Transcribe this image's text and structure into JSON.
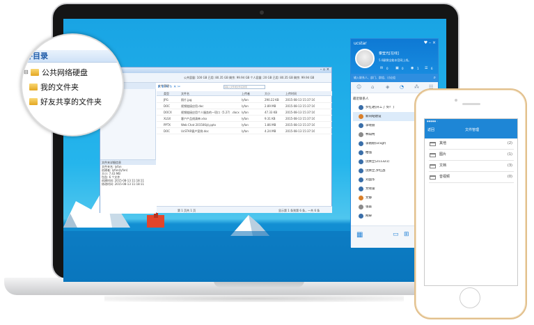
{
  "lens": {
    "title": "件目录",
    "items": [
      "公共网络硬盘",
      "我的文件夹",
      "好友共享的文件夹"
    ]
  },
  "file_manager": {
    "header": "文件管理",
    "quota": "公共容量: 100 GB  已用: 80.35 GB  剩余: 99.94 GB  个人容量: 20 GB  已用: 80.35 GB  剩余: 99.94 GB",
    "search_placeholder": "请输入文件或文件名搜索",
    "columns": [
      "类型",
      "文件名",
      "上传者",
      "大小",
      "上传时间"
    ],
    "rows": [
      {
        "type": "JPG",
        "name": "照片.jpg",
        "uploader": "lyfan",
        "size": "290.22 KB",
        "time": "2015-08-13 15:37:16"
      },
      {
        "type": "DOC",
        "name": "视频链接应用.doc",
        "uploader": "lyfan",
        "size": "2.89 MB",
        "time": "2015-08-13 15:37:16"
      },
      {
        "type": "DOCX",
        "name": "视频链接应用个人服务的一项口（5.27）.docx",
        "uploader": "lyfan",
        "size": "47.33 KB",
        "time": "2015-08-13 15:37:16"
      },
      {
        "type": "XLSX",
        "name": "客户产品线清单.xlsx",
        "uploader": "lyfan",
        "size": "9.31 KB",
        "time": "2015-08-13 15:37:16"
      },
      {
        "type": "PPTX",
        "name": "Web Chat 201506训.pptx",
        "uploader": "lyfan",
        "size": "1.86 MB",
        "time": "2015-08-13 15:37:16"
      },
      {
        "type": "DOC",
        "name": "UcSTAR客户案例.doc",
        "uploader": "lyfan",
        "size": "4.24 MB",
        "time": "2015-08-13 15:37:16"
      }
    ],
    "detail_title": "文件夹详细信息",
    "detail_lines": [
      "文件夹名: lyfan",
      "创建者: lyfan(lyfan)",
      "大小: 7.43 MB",
      "包含: 6 个文件",
      "创建时间: 2015-08-13 11:18:11",
      "修改时间: 2015-08-13 11:18:11"
    ],
    "pager": "第 1 页共 1 页",
    "status": "显示第 1 条到第 6 条，一共 6 条"
  },
  "ucstar": {
    "app_name": "ucstar",
    "user_name": "秦莹光[在线]",
    "signature": "5.0颠倒全能本官网上线。",
    "counts": [
      "0",
      "0",
      "1",
      "6"
    ],
    "search_placeholder": "输入联系人、部门、群组、讨论组",
    "section": "最近联系人",
    "contacts": [
      "罗红艳[开工了 好！]",
      "新同站建设",
      "李晓丽",
      "林琪柯",
      "李刚刚(vcxgf)",
      "柏强",
      "饶焕立(211321)",
      "饶焕立,罗红战",
      "刘国华",
      "文晓雷",
      "文静",
      "张森",
      "网卓"
    ]
  },
  "phone": {
    "back": "返回",
    "title": "文件管理",
    "items": [
      {
        "label": "其他",
        "count": "(2)"
      },
      {
        "label": "图片",
        "count": "(1)"
      },
      {
        "label": "文档",
        "count": "(3)"
      },
      {
        "label": "音视频",
        "count": "(0)"
      }
    ]
  }
}
